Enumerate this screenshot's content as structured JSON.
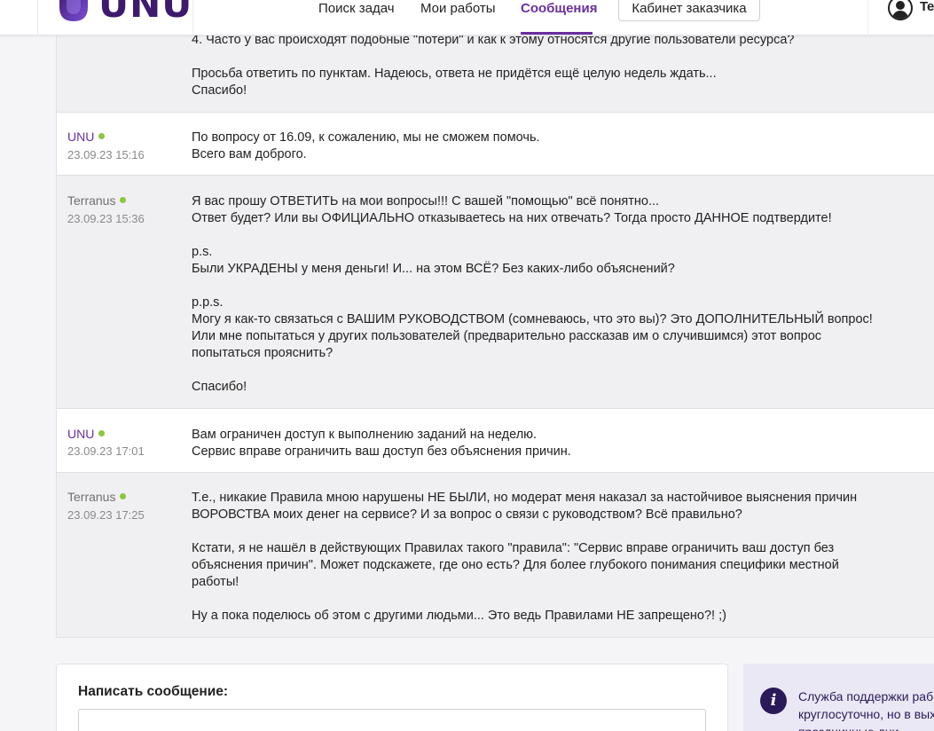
{
  "header": {
    "logo_text": "UNU",
    "nav": {
      "search": "Поиск задач",
      "works": "Мои работы",
      "messages": "Сообщения"
    },
    "cabinet_button": "Кабинет заказчика",
    "user_name": "Te"
  },
  "messages": [
    {
      "author": "",
      "date": "",
      "body": "4. Часто у вас происходят подобные \"потери\" и как к этому относятся другие пользователи ресурса?\n\nПросьба ответить по пунктам. Надеюсь, ответа не придётся ещё целую недель ждать...\nСпасибо!"
    },
    {
      "author": "UNU",
      "date": "23.09.23 15:16",
      "body": "По вопросу от 16.09, к сожалению, мы не сможем помочь.\nВсего вам доброго."
    },
    {
      "author": "Terranus",
      "date": "23.09.23 15:36",
      "body": "Я вас прошу ОТВЕТИТЬ на мои вопросы!!! С вашей \"помощью\" всё понятно...\nОтвет будет? Или вы ОФИЦИАЛЬНО отказываетесь на них отвечать? Тогда просто ДАННОЕ подтвердите!\n\np.s.\nБыли УКРАДЕНЫ у меня деньги! И... на этом ВСЁ? Без каких-либо объяснений?\n\np.p.s.\nМогу я как-то связаться с ВАШИМ РУКОВОДСТВОМ (сомневаюсь, что это вы)? Это ДОПОЛНИТЕЛЬНЫЙ вопрос!\nИли мне попытаться у других пользователей (предварительно рассказав им о случившимся) этот вопрос\nпопытаться прояснить?\n\nСпасибо!"
    },
    {
      "author": "UNU",
      "date": "23.09.23 17:01",
      "body": "Вам ограничен доступ к выполнению заданий на неделю.\nСервис вправе ограничить ваш доступ без объяснения причин."
    },
    {
      "author": "Terranus",
      "date": "23.09.23 17:25",
      "body": "Т.е., никакие Правила мною нарушены НЕ БЫЛИ, но модерат меня наказал за настойчивое выяснения причин\nВОРОВСТВА моих денег на сервисе? И за вопрос о связи с руководством? Всё правильно?\n\nКстати, я не нашёл в действующих Правилах такого \"правила\": \"Сервис вправе ограничить ваш доступ без\nобъяснения причин\". Может подскажете, где оно есть? Для более глубокого понимания специфики местной\nработы!\n\nНу а пока поделюсь об этом с другими людьми... Это ведь Правилами НЕ запрещено?! ;)"
    }
  ],
  "compose": {
    "title": "Написать сообщение:"
  },
  "info": {
    "icon": "i",
    "text": "Служба поддержки раб\nкруглосуточно, но в вых\nпраздничные дни возможны з"
  },
  "colors": {
    "accent": "#6b2fa0",
    "online": "#8dc63f",
    "info_bg": "#ebe8f5",
    "info_icon": "#2b1a5a"
  }
}
